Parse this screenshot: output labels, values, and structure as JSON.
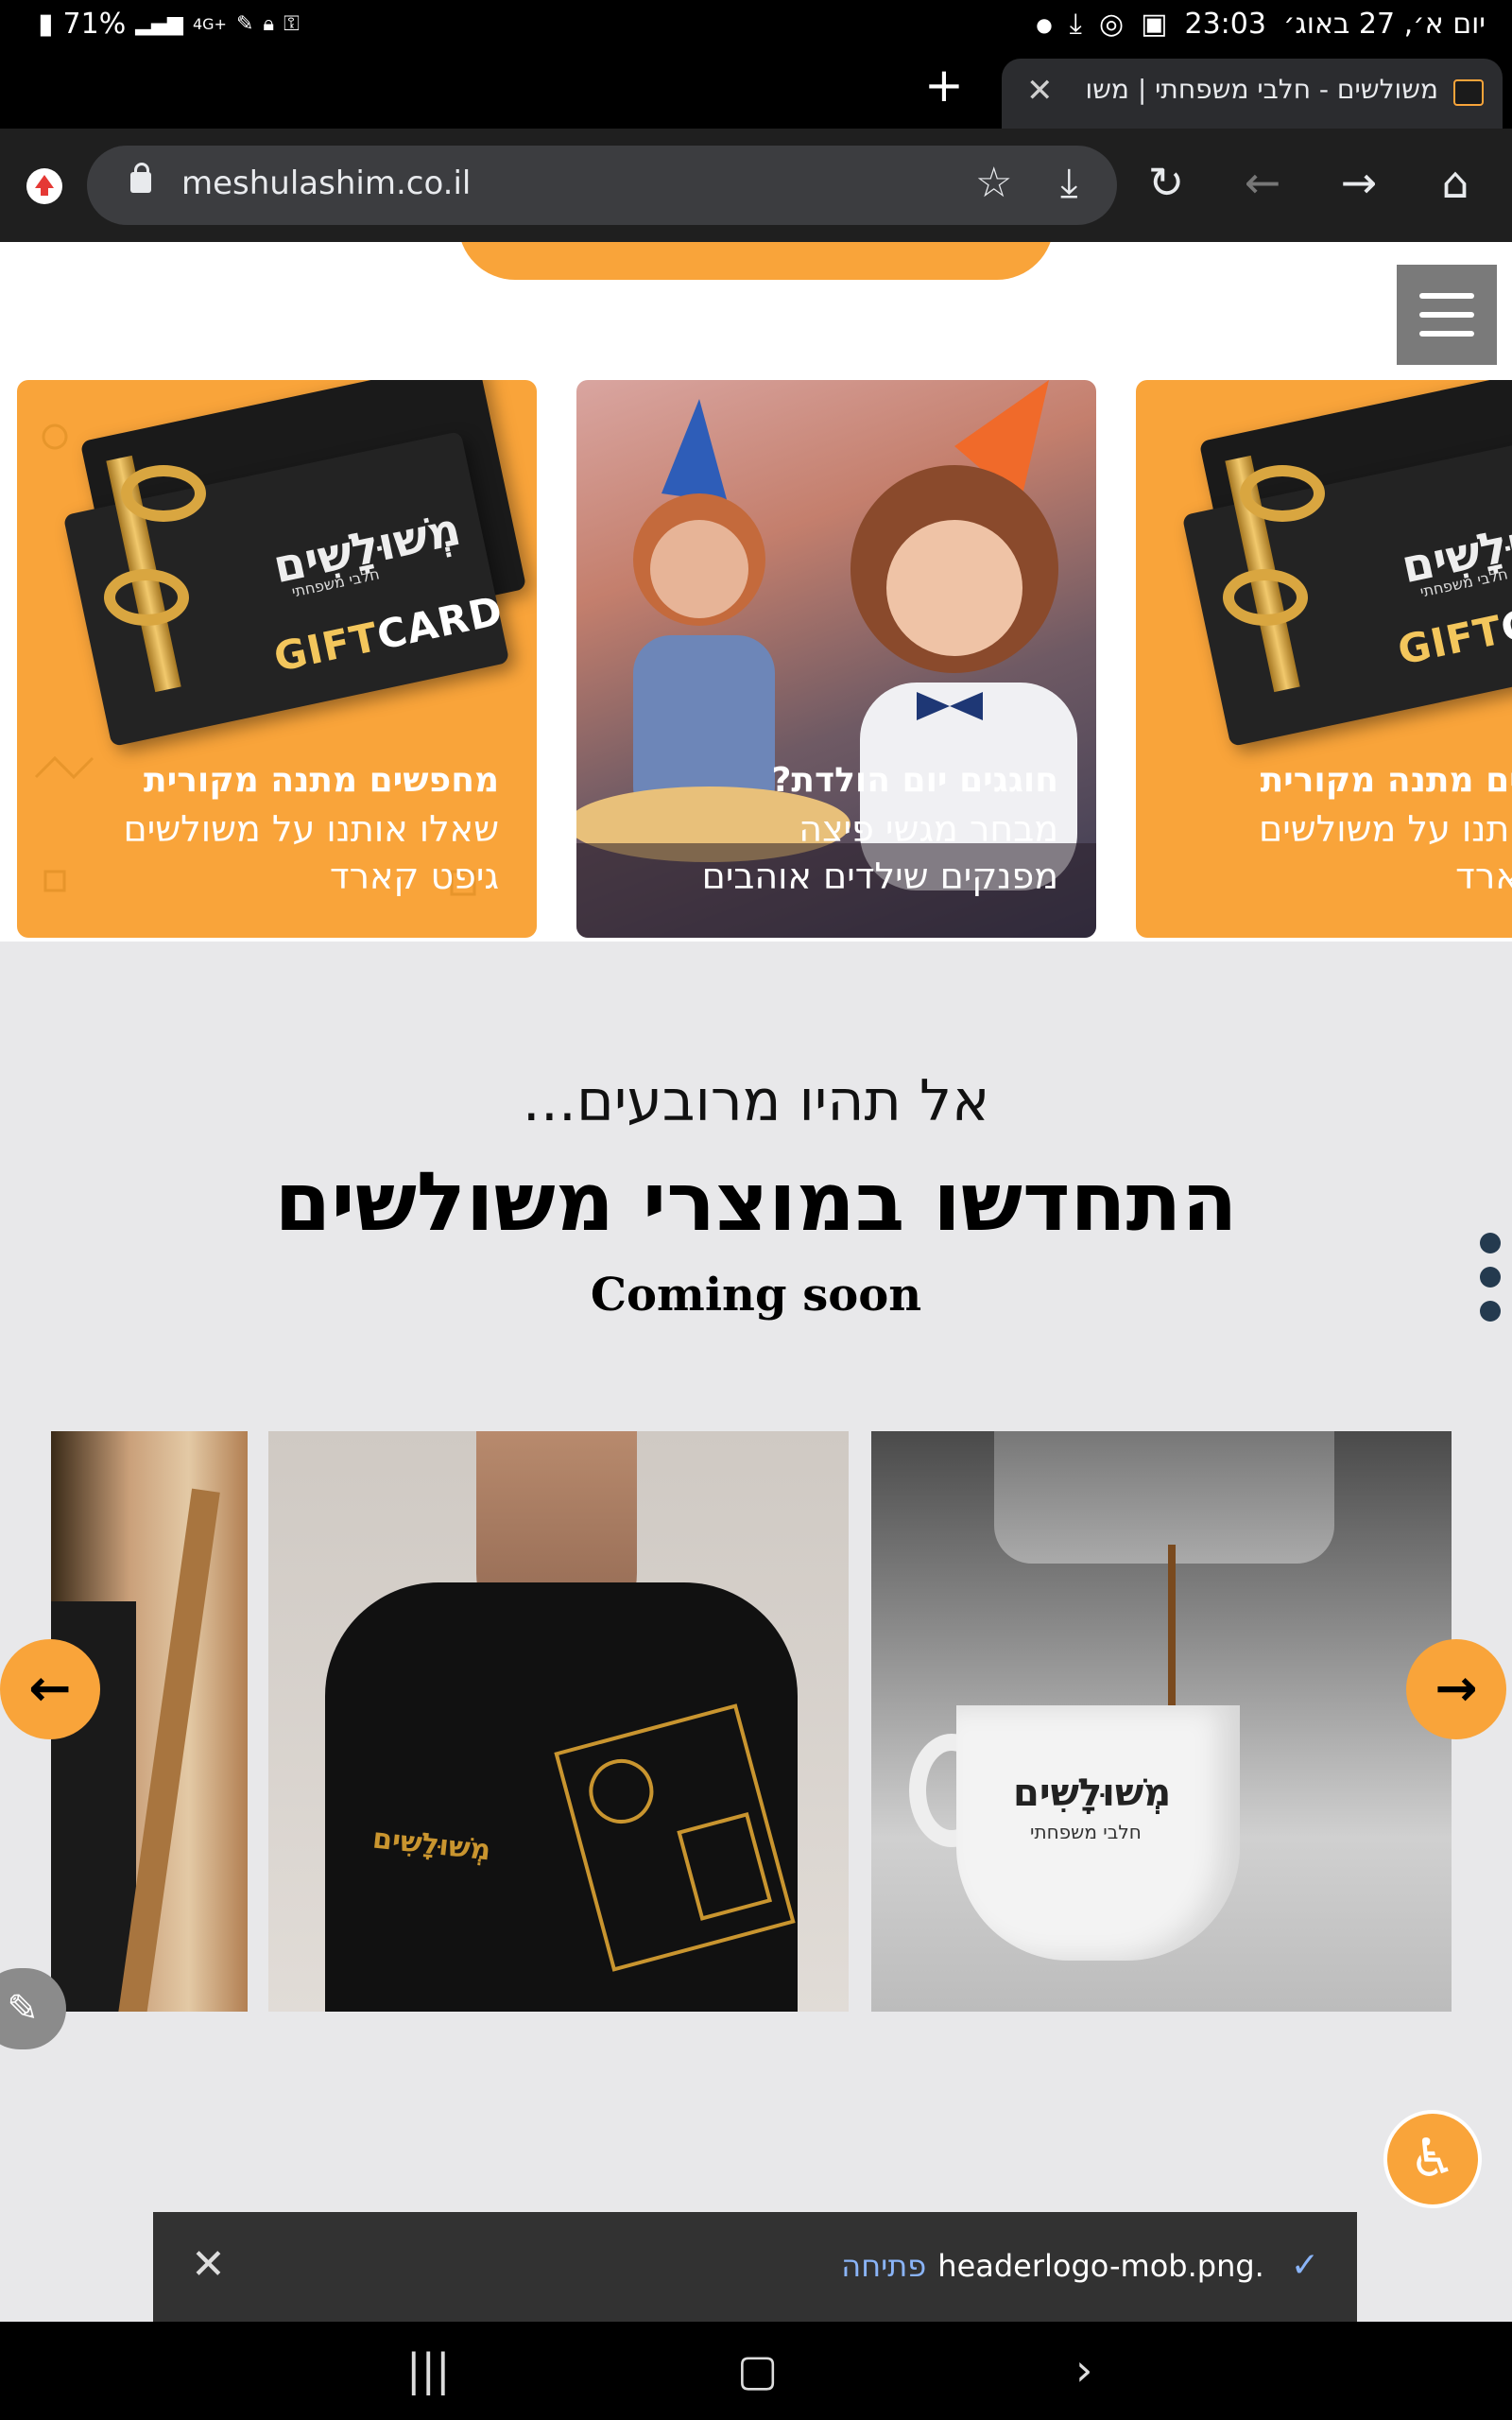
{
  "status_bar": {
    "battery": "71%",
    "network": "4G+",
    "time": "23:03",
    "date": "יום א׳, 27 באוג׳"
  },
  "tab": {
    "title": "משולשים - חלבי משפחתי | משו"
  },
  "url_bar": {
    "url": "meshulashim.co.il"
  },
  "promos": [
    {
      "heading": "מחפשים מתנה מקורית",
      "line1": "שאלו אותנו על משולשים",
      "line2": "גיפט קארד",
      "card_brand": "מְשׁוּלָשִׁים",
      "card_tagline": "חלבי משפחתי",
      "card_gift": "GIFT",
      "card_card": "CARD"
    },
    {
      "heading": "חוגגים יום הולדת?",
      "line1": "מבחר מגשי פיצה",
      "line2": "מפנקים שילדים אוהבים"
    },
    {
      "heading": "ים מתנה מקורית",
      "line1": "ותנו על משולשים",
      "line2": "ארד",
      "card_brand": "מְשׁוּלָשִׁים",
      "card_tagline": "חלבי משפחתי",
      "card_gift": "GIFT",
      "card_card": "CA"
    }
  ],
  "section": {
    "subtitle": "אל תהיו מרובעים...",
    "title": "התחדשו במוצרי משולשים",
    "coming_soon": "Coming soon"
  },
  "products": {
    "shirt_logo": "מְשׁוּלָשִׁים",
    "cup_logo": "מְשׁוּלָשִׁים",
    "cup_tagline": "חלבי משפחתי"
  },
  "download": {
    "filename": "headerlogo-mob.png.",
    "open_label": "פתיחה"
  },
  "colors": {
    "brand_orange": "#f9a43a",
    "page_bg": "#e8e8ea",
    "dots": "#243a4f"
  },
  "icons": [
    "plus-icon",
    "close-icon",
    "lock-icon",
    "star-icon",
    "download-icon",
    "reload-icon",
    "back-icon",
    "forward-icon",
    "home-icon",
    "menu-icon",
    "arrow-left-icon",
    "arrow-right-icon",
    "pencil-icon",
    "accessibility-icon",
    "phone-icon",
    "check-icon"
  ]
}
